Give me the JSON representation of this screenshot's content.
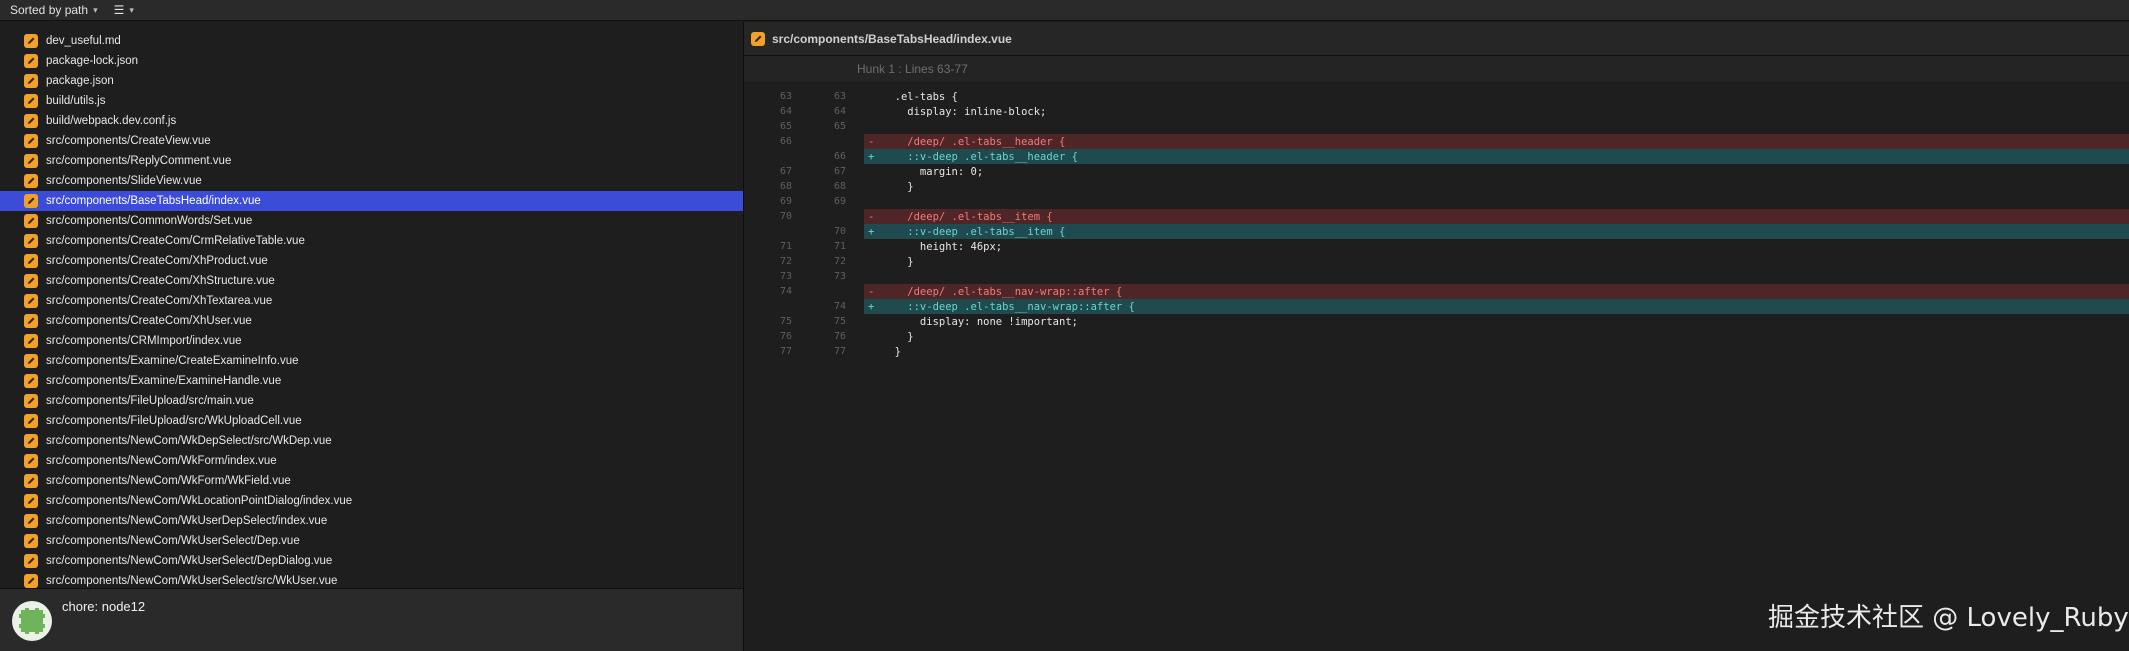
{
  "toolbar": {
    "sort_label": "Sorted by path",
    "view_icon": "list-icon"
  },
  "files": [
    "dev_useful.md",
    "package-lock.json",
    "package.json",
    "build/utils.js",
    "build/webpack.dev.conf.js",
    "src/components/CreateView.vue",
    "src/components/ReplyComment.vue",
    "src/components/SlideView.vue",
    "src/components/BaseTabsHead/index.vue",
    "src/components/CommonWords/Set.vue",
    "src/components/CreateCom/CrmRelativeTable.vue",
    "src/components/CreateCom/XhProduct.vue",
    "src/components/CreateCom/XhStructure.vue",
    "src/components/CreateCom/XhTextarea.vue",
    "src/components/CreateCom/XhUser.vue",
    "src/components/CRMImport/index.vue",
    "src/components/Examine/CreateExamineInfo.vue",
    "src/components/Examine/ExamineHandle.vue",
    "src/components/FileUpload/src/main.vue",
    "src/components/FileUpload/src/WkUploadCell.vue",
    "src/components/NewCom/WkDepSelect/src/WkDep.vue",
    "src/components/NewCom/WkForm/index.vue",
    "src/components/NewCom/WkForm/WkField.vue",
    "src/components/NewCom/WkLocationPointDialog/index.vue",
    "src/components/NewCom/WkUserDepSelect/index.vue",
    "src/components/NewCom/WkUserSelect/Dep.vue",
    "src/components/NewCom/WkUserSelect/DepDialog.vue",
    "src/components/NewCom/WkUserSelect/src/WkUser.vue"
  ],
  "selected_file_index": 8,
  "commit": {
    "message": "chore: node12"
  },
  "diff": {
    "file_path": "src/components/BaseTabsHead/index.vue",
    "hunk_label": "Hunk 1 : Lines 63-77",
    "lines": [
      {
        "old": "63",
        "new": "63",
        "type": "ctx",
        "marker": "",
        "text": "  .el-tabs {"
      },
      {
        "old": "64",
        "new": "64",
        "type": "ctx",
        "marker": "",
        "text": "    display: inline-block;"
      },
      {
        "old": "65",
        "new": "65",
        "type": "ctx",
        "marker": "",
        "text": ""
      },
      {
        "old": "66",
        "new": "",
        "type": "del",
        "marker": "-",
        "text": "    /deep/ .el-tabs__header {"
      },
      {
        "old": "",
        "new": "66",
        "type": "add",
        "marker": "+",
        "text": "    ::v-deep .el-tabs__header {"
      },
      {
        "old": "67",
        "new": "67",
        "type": "ctx",
        "marker": "",
        "text": "      margin: 0;"
      },
      {
        "old": "68",
        "new": "68",
        "type": "ctx",
        "marker": "",
        "text": "    }"
      },
      {
        "old": "69",
        "new": "69",
        "type": "ctx",
        "marker": "",
        "text": ""
      },
      {
        "old": "70",
        "new": "",
        "type": "del",
        "marker": "-",
        "text": "    /deep/ .el-tabs__item {"
      },
      {
        "old": "",
        "new": "70",
        "type": "add",
        "marker": "+",
        "text": "    ::v-deep .el-tabs__item {"
      },
      {
        "old": "71",
        "new": "71",
        "type": "ctx",
        "marker": "",
        "text": "      height: 46px;"
      },
      {
        "old": "72",
        "new": "72",
        "type": "ctx",
        "marker": "",
        "text": "    }"
      },
      {
        "old": "73",
        "new": "73",
        "type": "ctx",
        "marker": "",
        "text": ""
      },
      {
        "old": "74",
        "new": "",
        "type": "del",
        "marker": "-",
        "text": "    /deep/ .el-tabs__nav-wrap::after {"
      },
      {
        "old": "",
        "new": "74",
        "type": "add",
        "marker": "+",
        "text": "    ::v-deep .el-tabs__nav-wrap::after {"
      },
      {
        "old": "75",
        "new": "75",
        "type": "ctx",
        "marker": "",
        "text": "      display: none !important;"
      },
      {
        "old": "76",
        "new": "76",
        "type": "ctx",
        "marker": "",
        "text": "    }"
      },
      {
        "old": "77",
        "new": "77",
        "type": "ctx",
        "marker": "",
        "text": "  }"
      }
    ]
  },
  "watermark": "掘金技术社区 @ Lovely_Ruby"
}
